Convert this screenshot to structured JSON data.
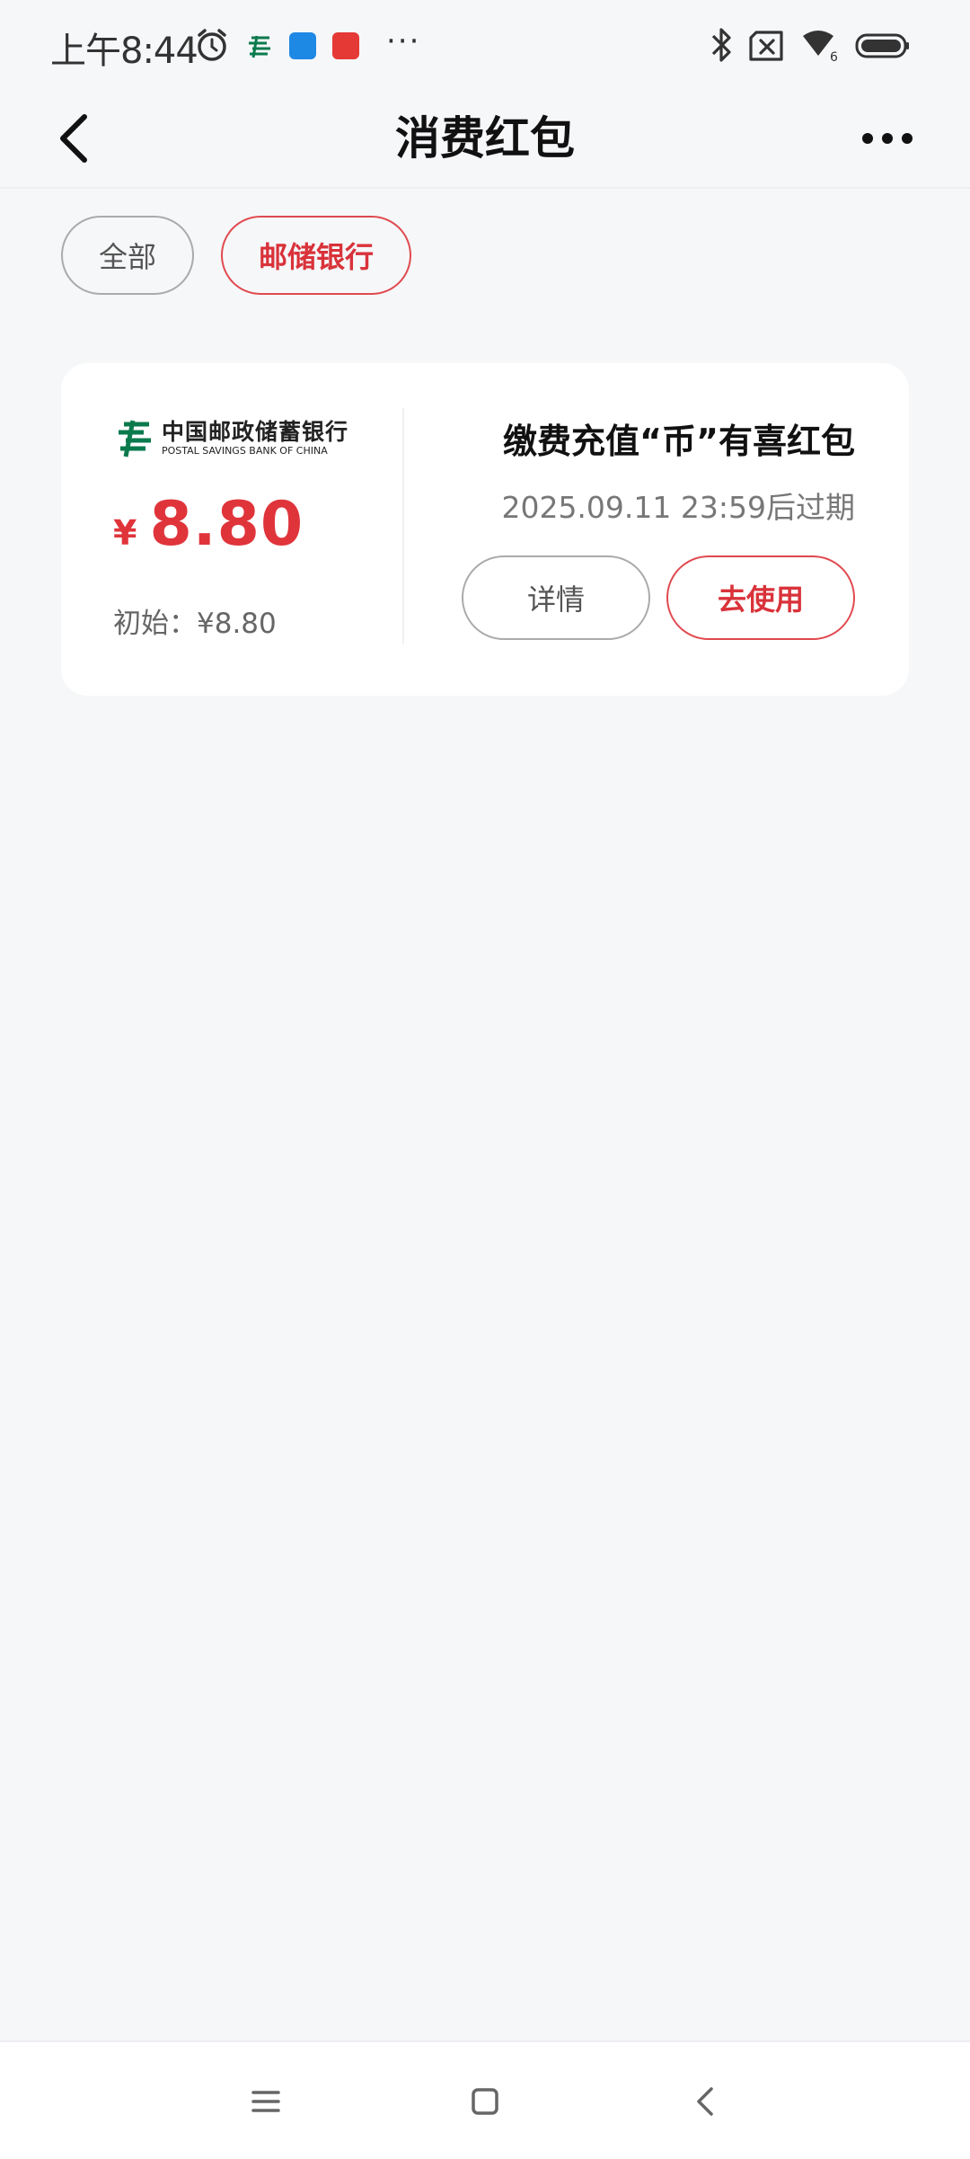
{
  "status_bar": {
    "time": "上午8:44",
    "overflow": "···",
    "icons": [
      "alarm-clock-icon",
      "psbc-app-icon",
      "blue-app-icon",
      "red-app-icon",
      "bluetooth-icon",
      "sim-off-icon",
      "wifi-icon",
      "battery-icon"
    ],
    "wifi_badge": "6"
  },
  "header": {
    "title": "消费红包",
    "back_icon": "back-arrow-icon",
    "more_icon": "more-dots-icon"
  },
  "filters": [
    {
      "label": "全部",
      "selected": false
    },
    {
      "label": "邮储银行",
      "selected": true
    }
  ],
  "voucher": {
    "logo_cn": "中国邮政储蓄银行",
    "logo_en": "POSTAL SAVINGS BANK OF CHINA",
    "currency_symbol": "¥",
    "amount": "8.80",
    "initial_text": "初始：¥8.80",
    "title": "缴费充值“币”有喜红包",
    "expiry": "2025.09.11 23:59后过期",
    "detail_button": "详情",
    "use_button": "去使用"
  },
  "colors": {
    "accent_red": "#e0343b",
    "page_bg": "#f6f7f9",
    "psbc_green": "#0a7a4c"
  },
  "system_nav": [
    "menu-icon",
    "home-icon",
    "back-icon"
  ]
}
